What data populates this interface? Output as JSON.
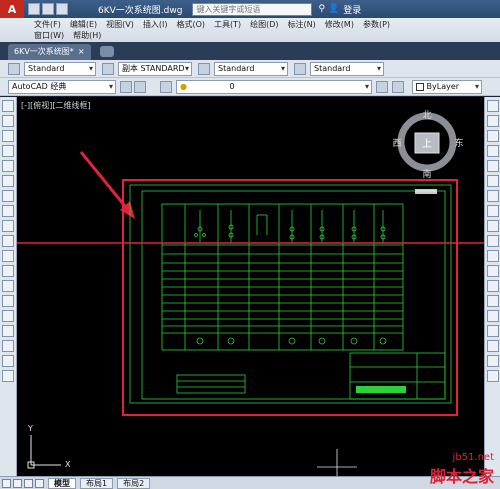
{
  "titlebar": {
    "logo": "A",
    "document_title": "6KV一次系统图.dwg",
    "search_placeholder": "键入关键字或短语",
    "login": "登录"
  },
  "menu": {
    "row1": [
      "文件(F)",
      "编辑(E)",
      "视图(V)",
      "插入(I)",
      "格式(O)",
      "工具(T)",
      "绘图(D)",
      "标注(N)",
      "修改(M)",
      "参数(P)"
    ],
    "row2": [
      "窗口(W)",
      "帮助(H)"
    ]
  },
  "tabs": {
    "file_tab": "6KV一次系统图*",
    "close": "×"
  },
  "toolbar1": {
    "text_style": "Standard",
    "dim_style": "副本 STANDARD",
    "table_style": "Standard",
    "multileader_style": "Standard"
  },
  "toolbar2": {
    "workspace": "AutoCAD 经典",
    "layer": "0",
    "color": "ByLayer"
  },
  "viewport": {
    "label": "[-][俯视][二维线框]",
    "viewcube": {
      "north": "北",
      "south": "南",
      "east": "东",
      "west": "西",
      "face": "上"
    },
    "ucs_x": "X",
    "ucs_y": "Y"
  },
  "layout_tabs": [
    "模型",
    "布局1",
    "布局2"
  ],
  "watermark": {
    "site": "jb51.net",
    "name": "脚本之家"
  },
  "colors": {
    "accent_red": "#e0233a",
    "drawing_green": "#2fd13a",
    "canvas": "#000000"
  }
}
